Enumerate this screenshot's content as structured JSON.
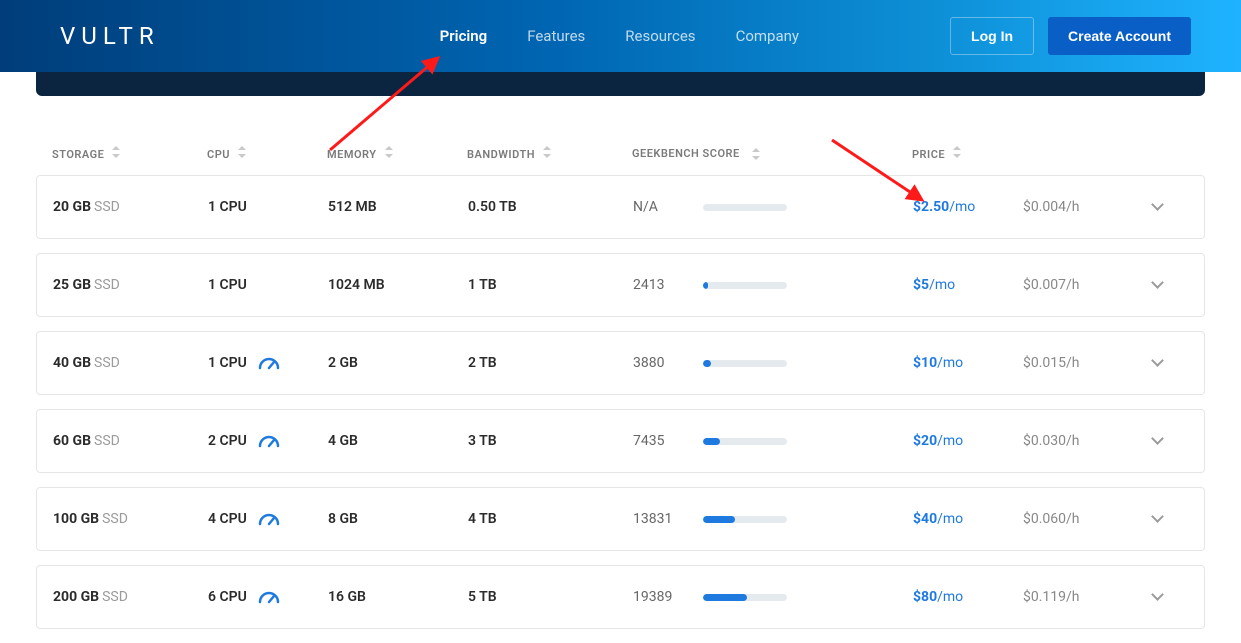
{
  "header": {
    "logo": "VULTR",
    "nav": [
      {
        "label": "Pricing",
        "active": true
      },
      {
        "label": "Features",
        "active": false
      },
      {
        "label": "Resources",
        "active": false
      },
      {
        "label": "Company",
        "active": false
      }
    ],
    "login": "Log In",
    "create": "Create Account"
  },
  "columns": {
    "storage": "STORAGE",
    "cpu": "CPU",
    "memory": "MEMORY",
    "bandwidth": "BANDWIDTH",
    "geekbench": "GEEKBENCH SCORE",
    "price": "PRICE"
  },
  "rows": [
    {
      "storage_gb": "20 GB",
      "cpu": "1 CPU",
      "gauge": false,
      "memory": "512 MB",
      "bandwidth": "0.50 TB",
      "geek_score": "N/A",
      "geek_pct": 0,
      "price": "$2.50",
      "per": "/mo",
      "hourly": "$0.004/h"
    },
    {
      "storage_gb": "25 GB",
      "cpu": "1 CPU",
      "gauge": false,
      "memory": "1024 MB",
      "bandwidth": "1 TB",
      "geek_score": "2413",
      "geek_pct": 6,
      "price": "$5",
      "per": "/mo",
      "hourly": "$0.007/h"
    },
    {
      "storage_gb": "40 GB",
      "cpu": "1 CPU",
      "gauge": true,
      "memory": "2 GB",
      "bandwidth": "2 TB",
      "geek_score": "3880",
      "geek_pct": 10,
      "price": "$10",
      "per": "/mo",
      "hourly": "$0.015/h"
    },
    {
      "storage_gb": "60 GB",
      "cpu": "2 CPU",
      "gauge": true,
      "memory": "4 GB",
      "bandwidth": "3 TB",
      "geek_score": "7435",
      "geek_pct": 20,
      "price": "$20",
      "per": "/mo",
      "hourly": "$0.030/h"
    },
    {
      "storage_gb": "100 GB",
      "cpu": "4 CPU",
      "gauge": true,
      "memory": "8 GB",
      "bandwidth": "4 TB",
      "geek_score": "13831",
      "geek_pct": 38,
      "price": "$40",
      "per": "/mo",
      "hourly": "$0.060/h"
    },
    {
      "storage_gb": "200 GB",
      "cpu": "6 CPU",
      "gauge": true,
      "memory": "16 GB",
      "bandwidth": "5 TB",
      "geek_score": "19389",
      "geek_pct": 52,
      "price": "$80",
      "per": "/mo",
      "hourly": "$0.119/h"
    }
  ],
  "ssd_label": "SSD"
}
